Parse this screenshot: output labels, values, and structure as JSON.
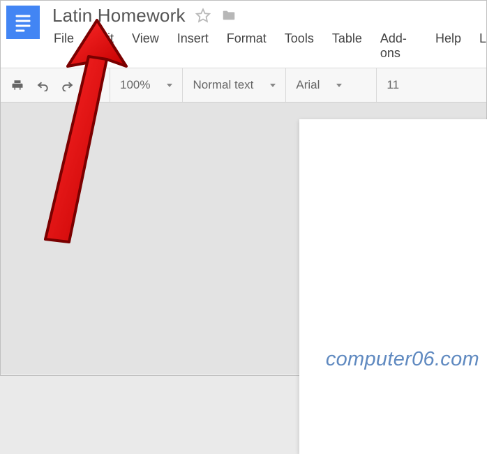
{
  "header": {
    "title": "Latin Homework"
  },
  "menu": {
    "items": [
      "File",
      "Edit",
      "View",
      "Insert",
      "Format",
      "Tools",
      "Table",
      "Add-ons",
      "Help",
      "L"
    ]
  },
  "toolbar": {
    "zoom": "100%",
    "paragraph_style": "Normal text",
    "font": "Arial",
    "font_size": "11"
  },
  "watermark": "computer06.com"
}
